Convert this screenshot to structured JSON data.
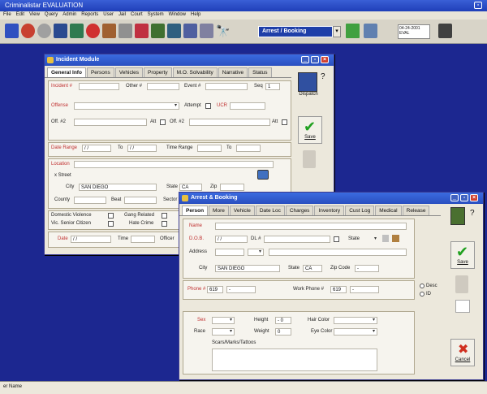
{
  "app": {
    "title": "Criminalistar  EVALUATION"
  },
  "menu": [
    "File",
    "Edit",
    "View",
    "Query",
    "Admin",
    "Reports",
    "User",
    "Jail",
    "Court",
    "System",
    "Window",
    "Help"
  ],
  "toolbar": {
    "module": "Arrest / Booking",
    "date": "04-24-2001",
    "status": "EVAL",
    "module_dd": "▾"
  },
  "statusbar": {
    "text": "er Name"
  },
  "incident": {
    "title": "Incident Module",
    "tabs": [
      "General Info",
      "Persons",
      "Vehicles",
      "Property",
      "M.O. Solvability",
      "Narrative",
      "Status"
    ],
    "labels": {
      "incident_no": "Incident #",
      "other_no": "Other #",
      "event_no": "Event #",
      "seq": "Seq",
      "seq_val": "1",
      "offense": "Offense",
      "attempt": "Attempt",
      "ucr": "UCR",
      "off2": "Off. #2",
      "att": "Att",
      "date_range": "Date Range",
      "date_val": "/ /",
      "to": "To",
      "to_val": "/ /",
      "time_range": "Time Range",
      "to2": "To",
      "location": "Location",
      "street": "x Street",
      "city": "City",
      "city_val": "SAN DIEGO",
      "state": "State",
      "state_val": "CA",
      "zip": "Zip",
      "county": "County",
      "beat": "Beat",
      "sector": "Sector",
      "dv": "Domestic Violence",
      "gang": "Gang Related",
      "senior": "Vic. Senior Citizen",
      "hate": "Hate Crime",
      "date": "Date",
      "date2_val": "/ /",
      "time": "Time",
      "officer": "Officer"
    },
    "side": {
      "dispatch": "Dispatch",
      "save": "Save"
    }
  },
  "arrest": {
    "title": "Arrest & Booking",
    "tabs": [
      "Person",
      "More",
      "Vehicle",
      "Date Loc",
      "Charges",
      "Inventory",
      "Cust Log",
      "Medical",
      "Release"
    ],
    "labels": {
      "name": "Name",
      "dob": "D.O.B.",
      "dob_val": "/ /",
      "dl": "DL #",
      "state": "State",
      "address": "Address",
      "city": "City",
      "city_val": "SAN DIEGO",
      "state2": "State",
      "state2_val": "CA",
      "zip": "Zip Code",
      "zip_val": "-",
      "phone": "Phone #",
      "phone_val": "619",
      "phone_dash": "-",
      "work_phone": "Work Phone #",
      "work_val": "619",
      "work_dash": "-",
      "desc": "Desc",
      "id": "ID",
      "sex": "Sex",
      "height": "Height",
      "height_val": "- 0",
      "hair": "Hair Color",
      "race": "Race",
      "weight": "Weight",
      "weight_val": "0",
      "eye": "Eye Color",
      "scars": "Scars/Marks/Tattoos"
    },
    "side": {
      "save": "Save",
      "cancel": "Cancel"
    }
  }
}
